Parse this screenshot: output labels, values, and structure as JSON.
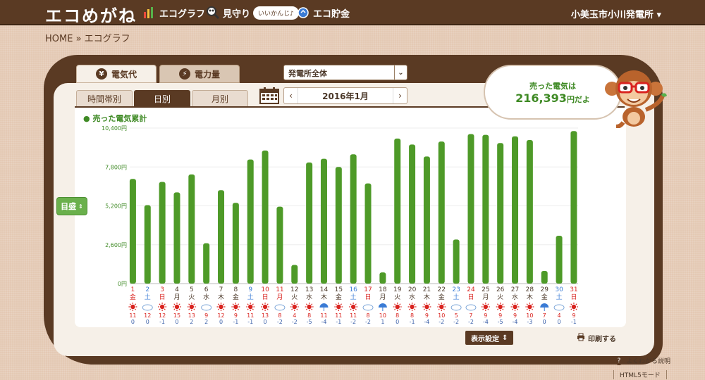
{
  "header": {
    "logo": "エコめがね",
    "nav": [
      {
        "label": "エコグラフ",
        "icon": "bar-chart-icon"
      },
      {
        "label": "見守り",
        "icon": "magnifier-icon"
      },
      {
        "label": "エコ貯金",
        "icon": "coin-icon"
      }
    ],
    "bubble": "いいかんじ♪",
    "plant_selector": "小美玉市小川発電所"
  },
  "breadcrumb": "HOME » エコグラフ",
  "main_tabs": [
    {
      "label": "電気代",
      "icon": "¥"
    },
    {
      "label": "電力量",
      "icon": "⚡"
    }
  ],
  "plant_dropdown": "発電所全体",
  "sub_tabs": [
    "時間帯別",
    "日別",
    "月別"
  ],
  "month_label": "2016年1月",
  "speech": {
    "line1": "売った電気は",
    "amount": "216,393",
    "suffix": "円だよ"
  },
  "mokuzumi_label": "目盛",
  "display_settings_label": "表示設定",
  "print_label": "印刷する",
  "help_label": "よくわかる説明",
  "html5_label": "HTML5モード",
  "colors": {
    "bar": "#4e9a28",
    "sun": "#d9231f",
    "saturday": "#3a7bd5",
    "holiday": "#d9231f",
    "brown": "#5a3a23"
  },
  "chart_data": {
    "type": "bar",
    "title": "売った電気累計",
    "ylim": [
      0,
      10400
    ],
    "yticks": [
      "0円",
      "2,600円",
      "5,200円",
      "7,800円",
      "10,400円"
    ],
    "y_tick_values": [
      0,
      2600,
      5200,
      7800,
      10400
    ],
    "days": [
      1,
      2,
      3,
      4,
      5,
      6,
      7,
      8,
      9,
      10,
      11,
      12,
      13,
      14,
      15,
      16,
      17,
      18,
      19,
      20,
      21,
      22,
      23,
      24,
      25,
      26,
      27,
      28,
      29,
      30,
      31
    ],
    "weekdays": [
      "金",
      "土",
      "日",
      "月",
      "火",
      "水",
      "木",
      "金",
      "土",
      "日",
      "月",
      "火",
      "水",
      "木",
      "金",
      "土",
      "日",
      "月",
      "火",
      "水",
      "木",
      "金",
      "土",
      "日",
      "月",
      "火",
      "水",
      "木",
      "金",
      "土",
      "日"
    ],
    "day_colors": [
      "holiday",
      "saturday",
      "holiday",
      "normal",
      "normal",
      "normal",
      "normal",
      "normal",
      "saturday",
      "holiday",
      "holiday",
      "normal",
      "normal",
      "normal",
      "normal",
      "saturday",
      "holiday",
      "normal",
      "normal",
      "normal",
      "normal",
      "normal",
      "saturday",
      "holiday",
      "normal",
      "normal",
      "normal",
      "normal",
      "normal",
      "saturday",
      "holiday"
    ],
    "weather": [
      "sun",
      "cloud",
      "sun",
      "sun",
      "sun",
      "cloud",
      "sun",
      "sun",
      "sun",
      "sun",
      "cloud",
      "sun",
      "sun",
      "rain",
      "sun",
      "sun",
      "cloud",
      "rain",
      "sun",
      "sun",
      "sun",
      "sun",
      "cloud",
      "cloud",
      "sun",
      "sun",
      "sun",
      "sun",
      "rain",
      "cloud",
      "sun"
    ],
    "temp_high": [
      11,
      12,
      12,
      15,
      13,
      9,
      12,
      9,
      11,
      13,
      8,
      4,
      8,
      11,
      11,
      11,
      8,
      10,
      8,
      8,
      9,
      10,
      5,
      7,
      9,
      9,
      9,
      10,
      7,
      4,
      9
    ],
    "temp_low": [
      0,
      0,
      -1,
      0,
      2,
      2,
      0,
      -1,
      -1,
      0,
      -2,
      -2,
      -5,
      -4,
      -1,
      -2,
      -2,
      1,
      0,
      -1,
      -4,
      -2,
      -2,
      -2,
      -4,
      -5,
      -4,
      -3,
      0,
      0,
      -1
    ],
    "values": [
      7000,
      5250,
      6800,
      6100,
      7300,
      2700,
      6250,
      5400,
      8300,
      8900,
      5150,
      1250,
      8100,
      8350,
      7800,
      8650,
      6700,
      750,
      9700,
      9300,
      8500,
      9500,
      2950,
      10000,
      9950,
      9400,
      9850,
      9600,
      850,
      3200,
      10200
    ]
  }
}
